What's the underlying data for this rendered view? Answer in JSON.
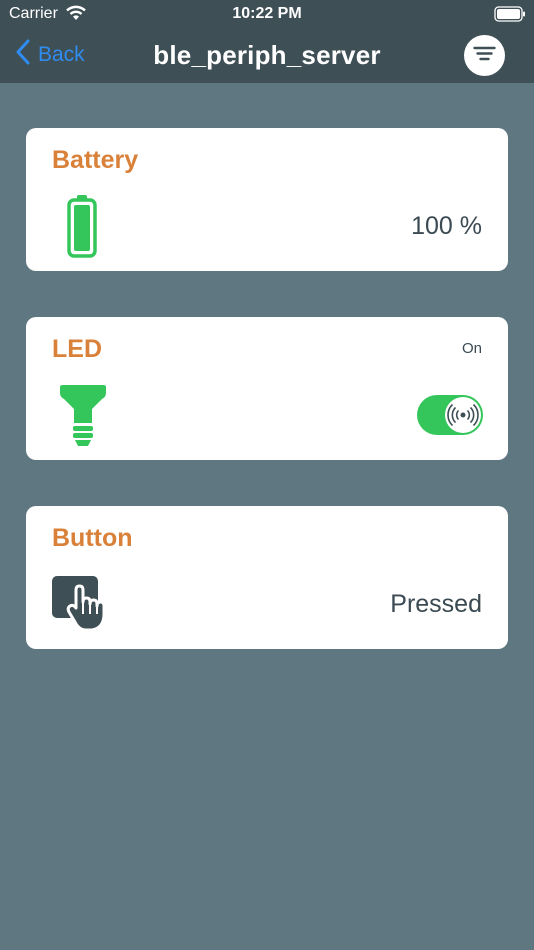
{
  "status_bar": {
    "carrier": "Carrier",
    "time": "10:22 PM"
  },
  "nav": {
    "back_label": "Back",
    "title": "ble_periph_server",
    "icons": {
      "back": "chevron-left-icon",
      "filter": "filter-icon"
    }
  },
  "cards": {
    "battery": {
      "title": "Battery",
      "value": "100 %",
      "icon": "battery-full-icon",
      "level": 1.0
    },
    "led": {
      "title": "LED",
      "state_label": "On",
      "icon": "light-bulb-icon",
      "toggle_on": true
    },
    "button": {
      "title": "Button",
      "value": "Pressed",
      "icon": "hand-press-icon"
    }
  },
  "colors": {
    "background": "#5e7780",
    "nav_bar": "#3f4f56",
    "accent_title": "#d98139",
    "green": "#34c65a",
    "link_blue": "#2f8cf0"
  }
}
